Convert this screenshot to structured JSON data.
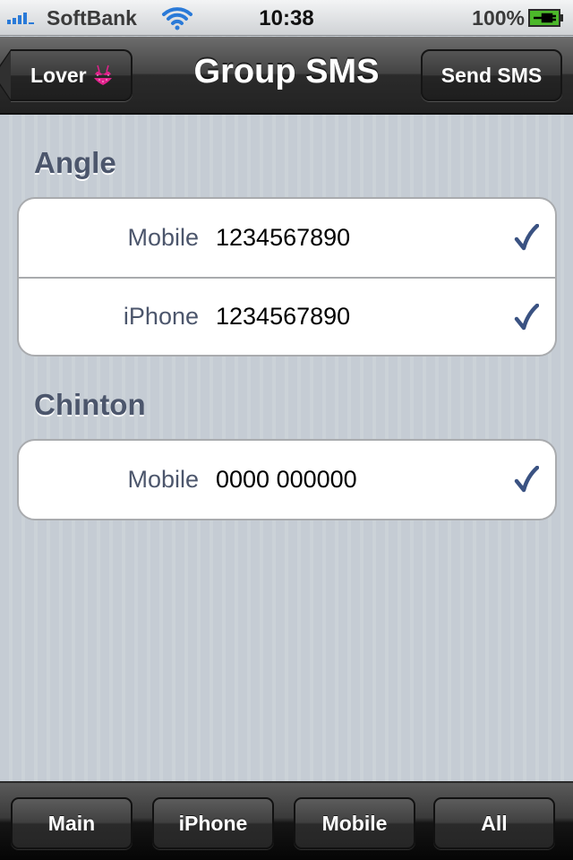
{
  "status_bar": {
    "carrier": "SoftBank",
    "time": "10:38",
    "battery": "100%",
    "signal_bars": 4,
    "battery_level_percent": 100,
    "battery_state": "charging"
  },
  "nav_bar": {
    "title": "Group SMS",
    "back_label": "Lover",
    "back_icon": "bikini-emoji-icon",
    "action_label": "Send SMS"
  },
  "sections": [
    {
      "header": "Angle",
      "rows": [
        {
          "label": "Mobile",
          "value": "1234567890",
          "checked": true
        },
        {
          "label": "iPhone",
          "value": "1234567890",
          "checked": true
        }
      ]
    },
    {
      "header": "Chinton",
      "rows": [
        {
          "label": "Mobile",
          "value": "0000 000000",
          "checked": true
        }
      ]
    }
  ],
  "toolbar": {
    "buttons": [
      {
        "label": "Main"
      },
      {
        "label": "iPhone"
      },
      {
        "label": "Mobile"
      },
      {
        "label": "All"
      }
    ]
  },
  "colors": {
    "accent_check": "#3a5282",
    "section_header": "#4c566c",
    "signal": "#2a7ad8",
    "battery": "#4cb82a",
    "bikini": "#e0228c"
  }
}
